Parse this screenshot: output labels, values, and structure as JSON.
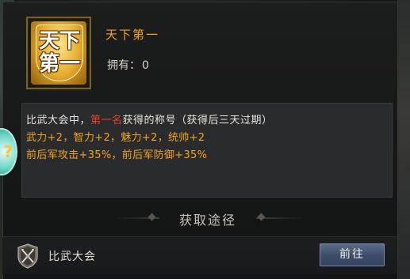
{
  "title_badge": {
    "line1": "天下",
    "line2": "第一"
  },
  "title_name": "天下第一",
  "owned": {
    "label": "拥有：",
    "value": "0"
  },
  "description": {
    "prefix": "比武大会中，",
    "highlight": "第一名",
    "suffix": "获得的称号（获得后三天过期）",
    "stats_line1": "武力+2，智力+2，魅力+2，统帅+2",
    "stats_line2": "前后军攻击+35%，前后军防御+35%"
  },
  "acquire_section": {
    "title": "获取途径"
  },
  "source": {
    "icon": "crossed-spears-shield-icon",
    "label": "比武大会",
    "go_button": "前往"
  },
  "colors": {
    "title_gold": "#f0a428",
    "highlight_red": "#e84030",
    "stat_orange": "#f2a41e",
    "button_blue": "#3f4f6b"
  }
}
